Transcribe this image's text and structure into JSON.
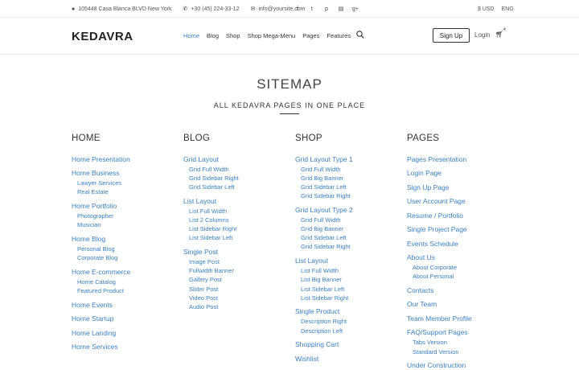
{
  "topbar": {
    "address": "105448 Casa Blanca BLVD New York",
    "phone": "+30 (45) 224-33-12",
    "email": "info@yoursite.com",
    "social": [
      {
        "icon": "facebook-icon",
        "glyph": "f"
      },
      {
        "icon": "twitter-icon",
        "glyph": "t"
      },
      {
        "icon": "pinterest-icon",
        "glyph": "p"
      },
      {
        "icon": "vk-icon",
        "glyph": "▤"
      },
      {
        "icon": "google-plus-icon",
        "glyph": "g+"
      }
    ],
    "currency": "$ USD",
    "language": "ENG"
  },
  "navbar": {
    "logo": "KEDAVRA",
    "menu": [
      "Home",
      "Blog",
      "Shop",
      "Shop Mega-Menu",
      "Pages",
      "Features"
    ],
    "signup": "Sign Up",
    "login": "Login",
    "cart_count": "4"
  },
  "page": {
    "title": "SITEMAP",
    "subtitle": "ALL KEDAVRA PAGES IN ONE PLACE"
  },
  "columns": [
    {
      "heading": "HOME",
      "groups": [
        {
          "label": "Home Presentation",
          "items": []
        },
        {
          "label": "Home Business",
          "items": [
            "Lawyer Services",
            "Real Estate"
          ]
        },
        {
          "label": "Home Portfolio",
          "items": [
            "Photographer",
            "Musician"
          ]
        },
        {
          "label": "Home Blog",
          "items": [
            "Personal Blog",
            "Corporate Blog"
          ]
        },
        {
          "label": "Home E-commerce",
          "items": [
            "Home Catalog",
            "Featured Product"
          ]
        },
        {
          "label": "Home Events",
          "items": []
        },
        {
          "label": "Home Startup",
          "items": []
        },
        {
          "label": "Home Landing",
          "items": []
        },
        {
          "label": "Home Services",
          "items": []
        }
      ]
    },
    {
      "heading": "BLOG",
      "groups": [
        {
          "label": "Grid Layout",
          "items": [
            "Grid Full Width",
            "Grid Sidebar Right",
            "Grid Sidebar Left"
          ]
        },
        {
          "label": "List Layout",
          "items": [
            "List Full Width",
            "List 2 Columns",
            "List Sidebar Right",
            "List Sidebar Left"
          ]
        },
        {
          "label": "Single Post",
          "items": [
            "Image Post",
            "Fullwidth Banner",
            "Gallery Post",
            "Slider Post",
            "Video Post",
            "Audio Post"
          ]
        }
      ]
    },
    {
      "heading": "SHOP",
      "groups": [
        {
          "label": "Grid Layout Type 1",
          "items": [
            "Grid Full Width",
            "Grid Big Banner",
            "Grid Sidebar Left",
            "Grid Sidebar Right"
          ]
        },
        {
          "label": "Grid Layout Type 2",
          "items": [
            "Grid Full Width",
            "Grid Big Banner",
            "Grid Sidebar Left",
            "Grid Sidebar Right"
          ]
        },
        {
          "label": "List Layout",
          "items": [
            "List Full Width",
            "List Big Banner",
            "List Sidebar Left",
            "List Sidebar Right"
          ]
        },
        {
          "label": "Single Product",
          "items": [
            "Description Right",
            "Description Left"
          ]
        },
        {
          "label": "Shopping Cart",
          "items": []
        },
        {
          "label": "Wishlist",
          "items": []
        }
      ]
    },
    {
      "heading": "PAGES",
      "groups": [
        {
          "label": "Pages Presentation",
          "items": []
        },
        {
          "label": "Login Page",
          "items": []
        },
        {
          "label": "Sign Up Page",
          "items": []
        },
        {
          "label": "User Account Page",
          "items": []
        },
        {
          "label": "Resume / Portfolio",
          "items": []
        },
        {
          "label": "Single Project Page",
          "items": []
        },
        {
          "label": "Events Schedule",
          "items": []
        },
        {
          "label": "About Us",
          "items": [
            "About Corporate",
            "About Personal"
          ]
        },
        {
          "label": "Contacts",
          "items": []
        },
        {
          "label": "Our Team",
          "items": []
        },
        {
          "label": "Team Member Profile",
          "items": []
        },
        {
          "label": "FAQ/Support Pages",
          "items": [
            "Tabs Version",
            "Standard Version"
          ]
        },
        {
          "label": "Under Construction",
          "items": []
        }
      ]
    }
  ]
}
